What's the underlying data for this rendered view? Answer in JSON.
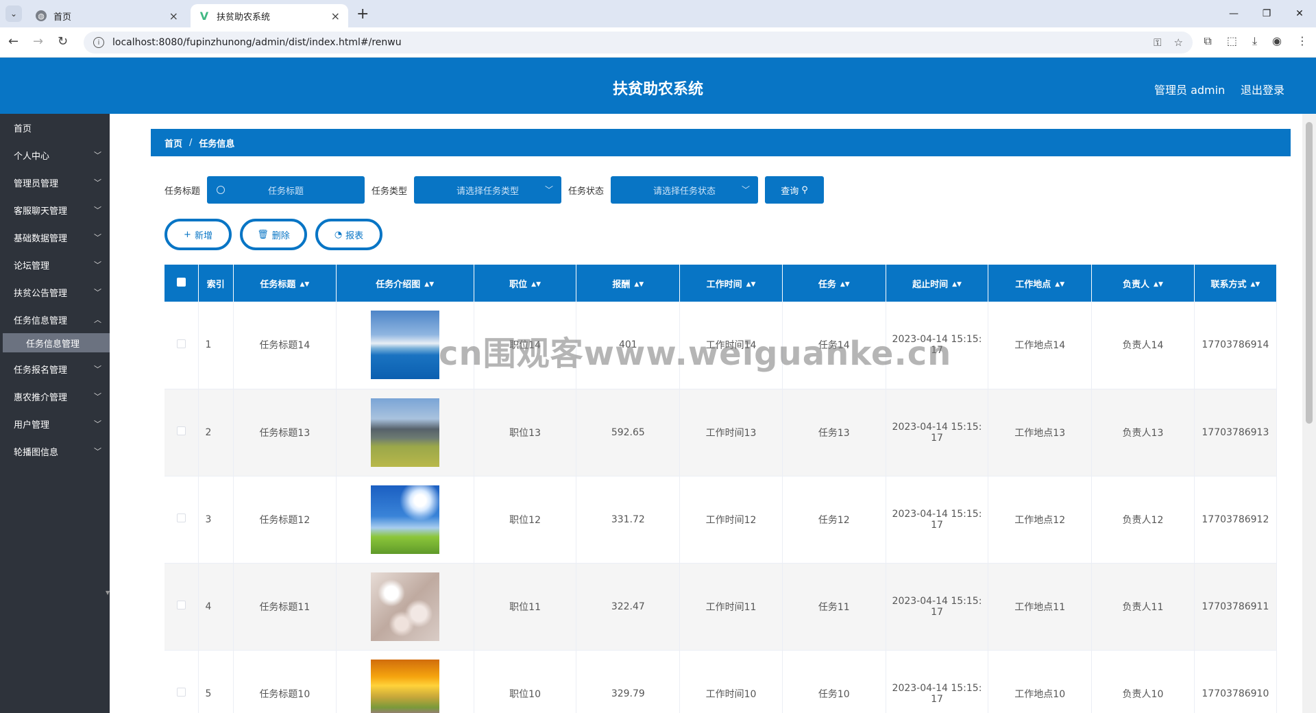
{
  "browser": {
    "tabs": [
      {
        "title": "首页",
        "active": false
      },
      {
        "title": "扶贫助农系统",
        "active": true
      }
    ],
    "url": "localhost:8080/fupinzhunong/admin/dist/index.html#/renwu"
  },
  "header": {
    "title": "扶贫助农系统",
    "user": "管理员 admin",
    "logout": "退出登录"
  },
  "sidebar": {
    "items": [
      {
        "label": "首页",
        "has_children": false
      },
      {
        "label": "个人中心",
        "has_children": true
      },
      {
        "label": "管理员管理",
        "has_children": true
      },
      {
        "label": "客服聊天管理",
        "has_children": true
      },
      {
        "label": "基础数据管理",
        "has_children": true
      },
      {
        "label": "论坛管理",
        "has_children": true
      },
      {
        "label": "扶贫公告管理",
        "has_children": true
      },
      {
        "label": "任务信息管理",
        "has_children": true,
        "expanded": true
      },
      {
        "label": "任务报名管理",
        "has_children": true
      },
      {
        "label": "惠农推介管理",
        "has_children": true
      },
      {
        "label": "用户管理",
        "has_children": true
      },
      {
        "label": "轮播图信息",
        "has_children": true
      }
    ],
    "active_sub": "任务信息管理"
  },
  "breadcrumb": {
    "home": "首页",
    "sep": "/",
    "current": "任务信息"
  },
  "search": {
    "title_label": "任务标题",
    "title_placeholder": "任务标题",
    "type_label": "任务类型",
    "type_placeholder": "请选择任务类型",
    "status_label": "任务状态",
    "status_placeholder": "请选择任务状态",
    "query_label": "查询"
  },
  "actions": {
    "add": "新增",
    "delete": "删除",
    "report": "报表"
  },
  "table": {
    "columns": [
      "索引",
      "任务标题",
      "任务介绍图",
      "职位",
      "报酬",
      "工作时间",
      "任务",
      "起止时间",
      "工作地点",
      "负责人",
      "联系方式"
    ],
    "rows": [
      {
        "index": "1",
        "title": "任务标题14",
        "image": "sea",
        "position": "职位14",
        "pay": "401",
        "time": "工作时间14",
        "task": "任务14",
        "range_date": "2023-04-14 15:15:",
        "range_sec": "17",
        "place": "工作地点14",
        "owner": "负责人14",
        "phone": "17703786914"
      },
      {
        "index": "2",
        "title": "任务标题13",
        "image": "mountain",
        "position": "职位13",
        "pay": "592.65",
        "time": "工作时间13",
        "task": "任务13",
        "range_date": "2023-04-14 15:15:",
        "range_sec": "17",
        "place": "工作地点13",
        "owner": "负责人13",
        "phone": "17703786913"
      },
      {
        "index": "3",
        "title": "任务标题12",
        "image": "sky",
        "position": "职位12",
        "pay": "331.72",
        "time": "工作时间12",
        "task": "任务12",
        "range_date": "2023-04-14 15:15:",
        "range_sec": "17",
        "place": "工作地点12",
        "owner": "负责人12",
        "phone": "17703786912"
      },
      {
        "index": "4",
        "title": "任务标题11",
        "image": "blossom",
        "position": "职位11",
        "pay": "322.47",
        "time": "工作时间11",
        "task": "任务11",
        "range_date": "2023-04-14 15:15:",
        "range_sec": "17",
        "place": "工作地点11",
        "owner": "负责人11",
        "phone": "17703786911"
      },
      {
        "index": "5",
        "title": "任务标题10",
        "image": "sunset",
        "position": "职位10",
        "pay": "329.79",
        "time": "工作时间10",
        "task": "任务10",
        "range_date": "2023-04-14 15:15:",
        "range_sec": "17",
        "place": "工作地点10",
        "owner": "负责人10",
        "phone": "17703786910"
      }
    ]
  },
  "watermark": "cn围观客www.weiguanke.cn",
  "colors": {
    "primary": "#0875c5",
    "sidebar_bg": "#2e333b",
    "active_sub_bg": "#6b7280"
  }
}
